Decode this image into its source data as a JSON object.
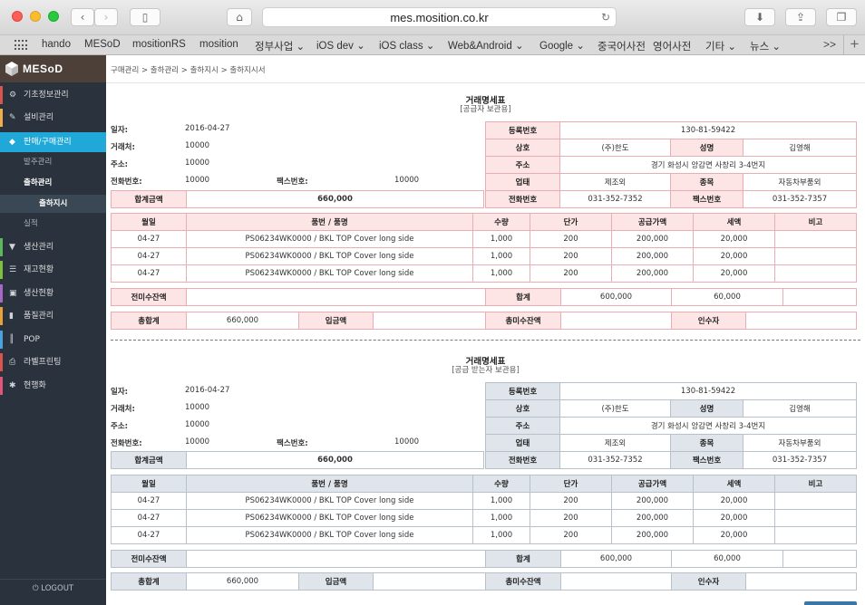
{
  "browser": {
    "url": "mes.mosition.co.kr",
    "nav_icons": [
      "chevron-left-icon",
      "chevron-right-icon",
      "sidebar-icon",
      "home-icon",
      "reload-icon",
      "download-icon",
      "share-icon",
      "tabs-icon"
    ]
  },
  "bookmarks": {
    "items": [
      "hando",
      "MESoD",
      "mositionRS",
      "mosition",
      "정부사업 ⌄",
      "iOS dev ⌄",
      "iOS class ⌄",
      "Web&Android ⌄",
      "Google ⌄",
      "중국어사전",
      "영어사전",
      "기타 ⌄",
      "뉴스 ⌄"
    ],
    "more": ">>",
    "add": "+"
  },
  "sidebar": {
    "logo": "MESoD",
    "items": [
      {
        "label": "기초정보관리",
        "icon": "gear-icon",
        "glyph": "⚙",
        "accent": "#d9534f"
      },
      {
        "label": "설비관리",
        "icon": "wrench-icon",
        "glyph": "✎",
        "accent": "#f0ad4e"
      },
      {
        "label": "판매/구매관리",
        "icon": "tag-icon",
        "glyph": "◆",
        "accent": "#1fa8d8"
      },
      {
        "label": "생산관리",
        "icon": "filter-icon",
        "glyph": "▼",
        "accent": "#5cb85c"
      },
      {
        "label": "재고현황",
        "icon": "list-icon",
        "glyph": "☰",
        "accent": "#7fbf3f"
      },
      {
        "label": "생산현황",
        "icon": "box-icon",
        "glyph": "▣",
        "accent": "#a768c8"
      },
      {
        "label": "품질관리",
        "icon": "chart-icon",
        "glyph": "▮",
        "accent": "#e8a23a"
      },
      {
        "label": "POP",
        "icon": "barcode-icon",
        "glyph": "║",
        "accent": "#4aa3df"
      },
      {
        "label": "라벨프린팅",
        "icon": "printer-icon",
        "glyph": "⎙",
        "accent": "#d9534f"
      },
      {
        "label": "현행화",
        "icon": "asterisk-icon",
        "glyph": "✱",
        "accent": "#e0567a"
      }
    ],
    "sub": {
      "order": "발주관리",
      "shipping": "출하관리",
      "shipping_instr": "출하지시",
      "result": "실적"
    },
    "logout": "LOGOUT"
  },
  "main": {
    "breadcrumb": "구매관리 > 출하관리 > 출하지시 > 출하지시서",
    "doc1": {
      "title": "거래명세표",
      "subtitle": "[공급자 보관용]"
    },
    "doc2": {
      "title": "거래명세표",
      "subtitle": "[공급 받는자 보관용]"
    },
    "info": {
      "date_label": "일자:",
      "date": "2016-04-27",
      "client_label": "거래처:",
      "client": "10000",
      "addr_label": "주소:",
      "addr": "10000",
      "phone_label": "전화번호:",
      "phone": "10000",
      "fax_label": "팩스번호:",
      "fax": "10000",
      "total_label": "합계금액",
      "total": "660,000"
    },
    "supplier": {
      "regno_label": "등록번호",
      "regno": "130-81-59422",
      "company_label": "상호",
      "company": "(주)한도",
      "name_label": "성명",
      "name": "김영해",
      "addr_label": "주소",
      "addr": "경기 화성시 앙감면 사창리 3-4번지",
      "type_label": "업태",
      "type": "제조외",
      "item_label": "종목",
      "item": "자동차부품외",
      "tel_label": "전화번호",
      "tel": "031-352-7352",
      "fax_label": "팩스번호",
      "fax": "031-352-7357"
    },
    "items_header": [
      "월일",
      "품번 / 품명",
      "수량",
      "단가",
      "공급가액",
      "세액",
      "비고"
    ],
    "items": [
      {
        "date": "04-27",
        "part": "PS06234WK0000 / BKL TOP Cover long side",
        "qty": "1,000",
        "price": "200",
        "supply": "200,000",
        "tax": "20,000",
        "note": ""
      },
      {
        "date": "04-27",
        "part": "PS06234WK0000 / BKL TOP Cover long side",
        "qty": "1,000",
        "price": "200",
        "supply": "200,000",
        "tax": "20,000",
        "note": ""
      },
      {
        "date": "04-27",
        "part": "PS06234WK0000 / BKL TOP Cover long side",
        "qty": "1,000",
        "price": "200",
        "supply": "200,000",
        "tax": "20,000",
        "note": ""
      }
    ],
    "summary": {
      "prev_label": "전미수잔액",
      "prev": "",
      "sum_label": "합계",
      "sum_supply": "600,000",
      "sum_tax": "60,000",
      "sum_extra": ""
    },
    "totals": {
      "total_label": "총합계",
      "total": "660,000",
      "deposit_label": "입금액",
      "deposit": "",
      "balance_label": "총미수잔액",
      "balance": "",
      "receiver_label": "인수자",
      "receiver": ""
    }
  }
}
